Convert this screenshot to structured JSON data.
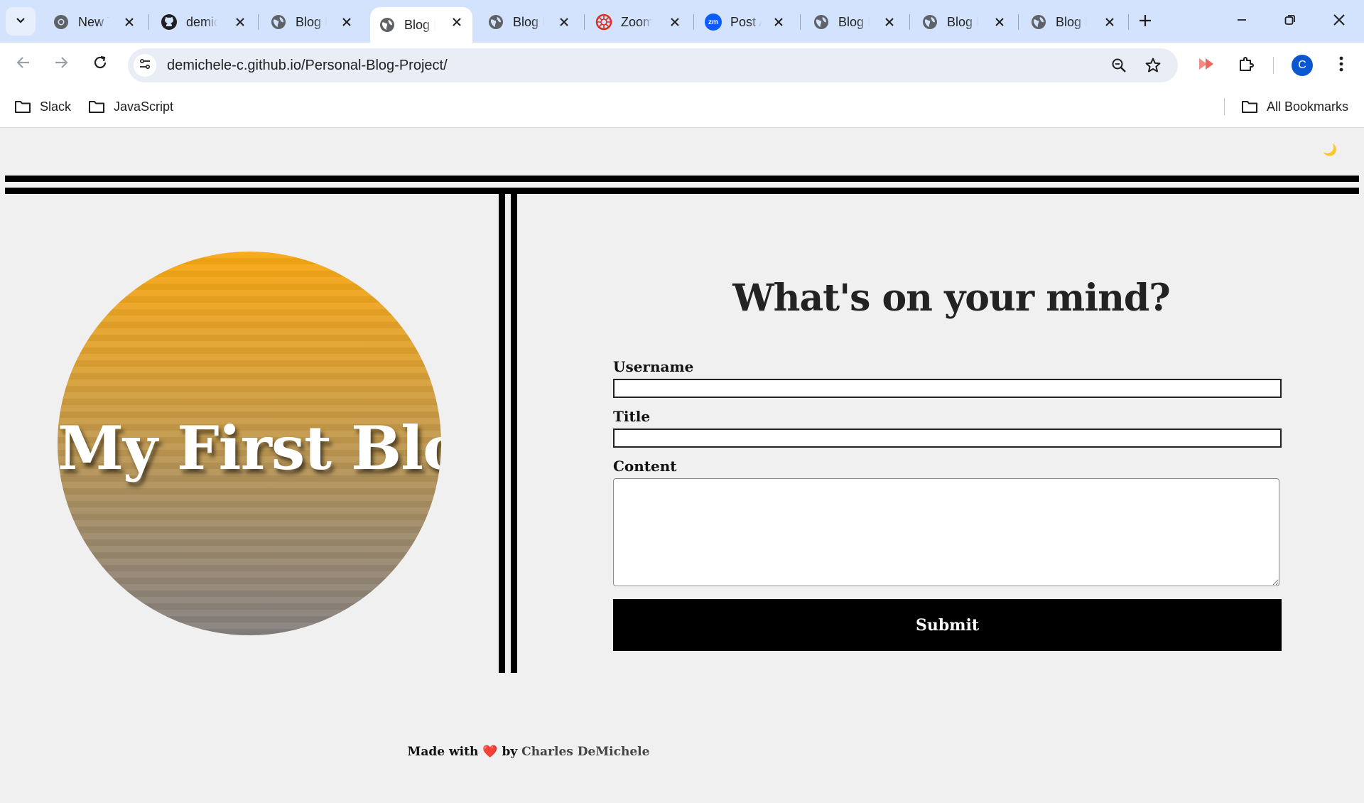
{
  "browser": {
    "tabs": [
      {
        "title": "New Tab",
        "icon": "chrome-icon",
        "active": false
      },
      {
        "title": "demichele-c",
        "icon": "github-icon",
        "active": false
      },
      {
        "title": "Blog Post",
        "icon": "globe-icon",
        "active": false
      },
      {
        "title": "Blog Post",
        "icon": "globe-icon",
        "active": true
      },
      {
        "title": "Blog Post",
        "icon": "globe-icon",
        "active": false
      },
      {
        "title": "Zoom",
        "icon": "zoom-app-icon",
        "active": false
      },
      {
        "title": "Post A",
        "icon": "zm-icon",
        "active": false
      },
      {
        "title": "Blog Post",
        "icon": "globe-icon",
        "active": false
      },
      {
        "title": "Blog Post",
        "icon": "globe-icon",
        "active": false
      },
      {
        "title": "Blog Post",
        "icon": "globe-icon",
        "active": false
      }
    ],
    "url": "demichele-c.github.io/Personal-Blog-Project/",
    "avatar_letter": "C",
    "bookmarks": [
      {
        "label": "Slack"
      },
      {
        "label": "JavaScript"
      }
    ],
    "all_bookmarks_label": "All Bookmarks"
  },
  "page": {
    "theme_toggle": "🌙",
    "blog_title": "My First Blog",
    "form": {
      "heading": "What's on your mind?",
      "username_label": "Username",
      "username_value": "",
      "title_label": "Title",
      "title_value": "",
      "content_label": "Content",
      "content_value": "",
      "submit_label": "Submit"
    },
    "footer": {
      "made_with": "Made with",
      "heart": "❤️",
      "by": "by",
      "author": "Charles DeMichele"
    }
  },
  "colors": {
    "tabstrip": "#d3e3fd",
    "page_bg": "#f0f0f0",
    "circle_top": "#f8a711",
    "circle_bottom": "#858080",
    "submit_bg": "#000000",
    "heart": "#e0262b"
  }
}
